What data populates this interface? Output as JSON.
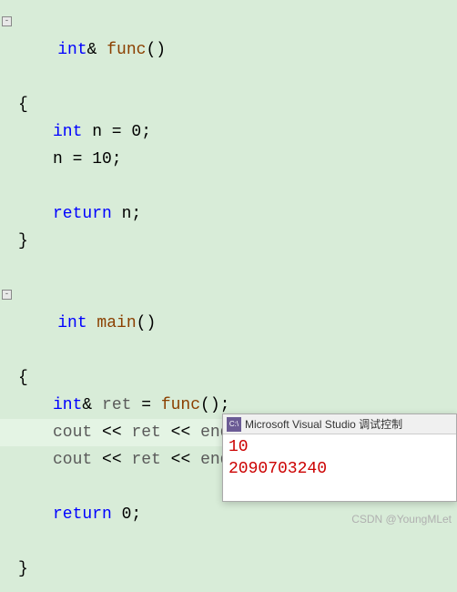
{
  "code": {
    "l1_kw1": "int",
    "l1_amp": "&",
    "l1_fn": "func",
    "l1_paren": "()",
    "l2_brace": "{",
    "l3_kw": "int",
    "l3_rest": " n = 0;",
    "l4_text": "n = 10;",
    "l5_kw": "return",
    "l5_rest": " n;",
    "l6_brace": "}",
    "l7_kw": "int",
    "l7_fn": " main",
    "l7_paren": "()",
    "l8_brace": "{",
    "l9_kw": "int",
    "l9_amp": "& ",
    "l9_id": "ret",
    "l9_eq": " = ",
    "l9_fn": "func",
    "l9_end": "();",
    "l10_id1": "cout",
    "l10_op1": " << ",
    "l10_id2": "ret",
    "l10_op2": " << ",
    "l10_id3": "endl",
    "l10_end": ";",
    "l11_id1": "cout",
    "l11_op1": " << ",
    "l11_id2": "ret",
    "l11_op2": " << ",
    "l11_id3": "endl",
    "l11_end": ";",
    "l12_kw": "return",
    "l12_rest": " 0;",
    "l13_brace": "}"
  },
  "fold": "-",
  "console": {
    "icon": "C:\\",
    "title": "Microsoft Visual Studio 调试控制",
    "line1": "10",
    "line2": "2090703240"
  },
  "watermark": "CSDN @YoungMLet"
}
